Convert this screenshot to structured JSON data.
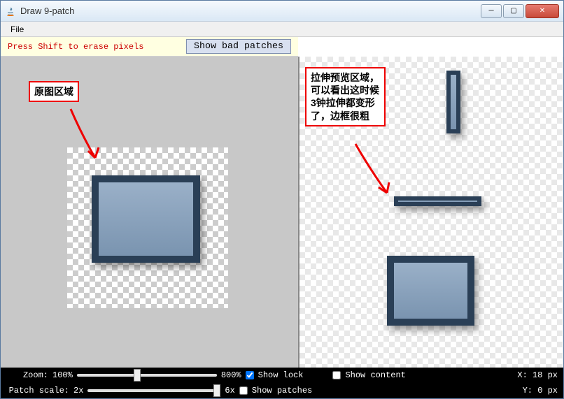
{
  "window": {
    "title": "Draw 9-patch"
  },
  "menu": {
    "file": "File"
  },
  "toolbar": {
    "hint": "Press Shift to erase pixels",
    "show_bad_patches": "Show bad patches"
  },
  "annotations": {
    "left": "原图区域",
    "right": "拉伸预览区域，可以看出这时候3钟拉伸都变形了，边框很粗"
  },
  "bottom": {
    "zoom_label": "Zoom:",
    "zoom_min": "100%",
    "zoom_max": "800%",
    "patch_scale_label": "Patch scale:",
    "patch_min": "2x",
    "patch_max": "6x",
    "show_lock": "Show lock",
    "show_content": "Show content",
    "show_patches": "Show patches",
    "x_label": "X:",
    "x_value": "18 px",
    "y_label": "Y:",
    "y_value": "0 px",
    "show_lock_checked": true,
    "show_content_checked": false,
    "show_patches_checked": false
  }
}
